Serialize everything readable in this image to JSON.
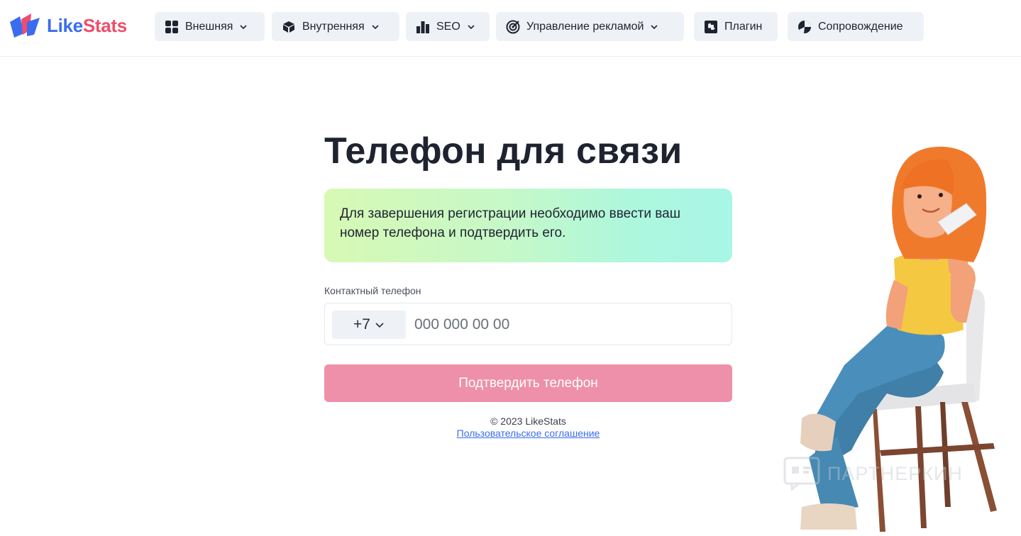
{
  "brand": {
    "like": "Like",
    "stats": "Stats"
  },
  "nav": [
    {
      "label": "Внешняя",
      "icon": "grid-icon",
      "dropdown": true
    },
    {
      "label": "Внутренняя",
      "icon": "cube-icon",
      "dropdown": true
    },
    {
      "label": "SEO",
      "icon": "bar-chart-icon",
      "dropdown": true
    },
    {
      "label": "Управление рекламой",
      "icon": "target-icon",
      "dropdown": true
    },
    {
      "label": "Плагин",
      "icon": "puzzle-icon",
      "dropdown": false
    },
    {
      "label": "Сопровождение",
      "icon": "pie-chart-icon",
      "dropdown": false
    }
  ],
  "main": {
    "title": "Телефон для связи",
    "notice": "Для завершения регистрации необходимо ввести ваш номер телефона и подтвердить его.",
    "phone_label": "Контактный телефон",
    "country_code": "+7",
    "phone_placeholder": "000 000 00 00",
    "submit_label": "Подтвердить телефон",
    "copyright": "© 2023 LikeStats",
    "agreement_link": "Пользовательское соглашение"
  },
  "watermark": "ПАРТНЕРКИН",
  "colors": {
    "brand_blue": "#3b6cf0",
    "brand_red": "#ef4d6c",
    "submit_bg": "#ee90aa",
    "nav_bg": "#eef1f6"
  }
}
